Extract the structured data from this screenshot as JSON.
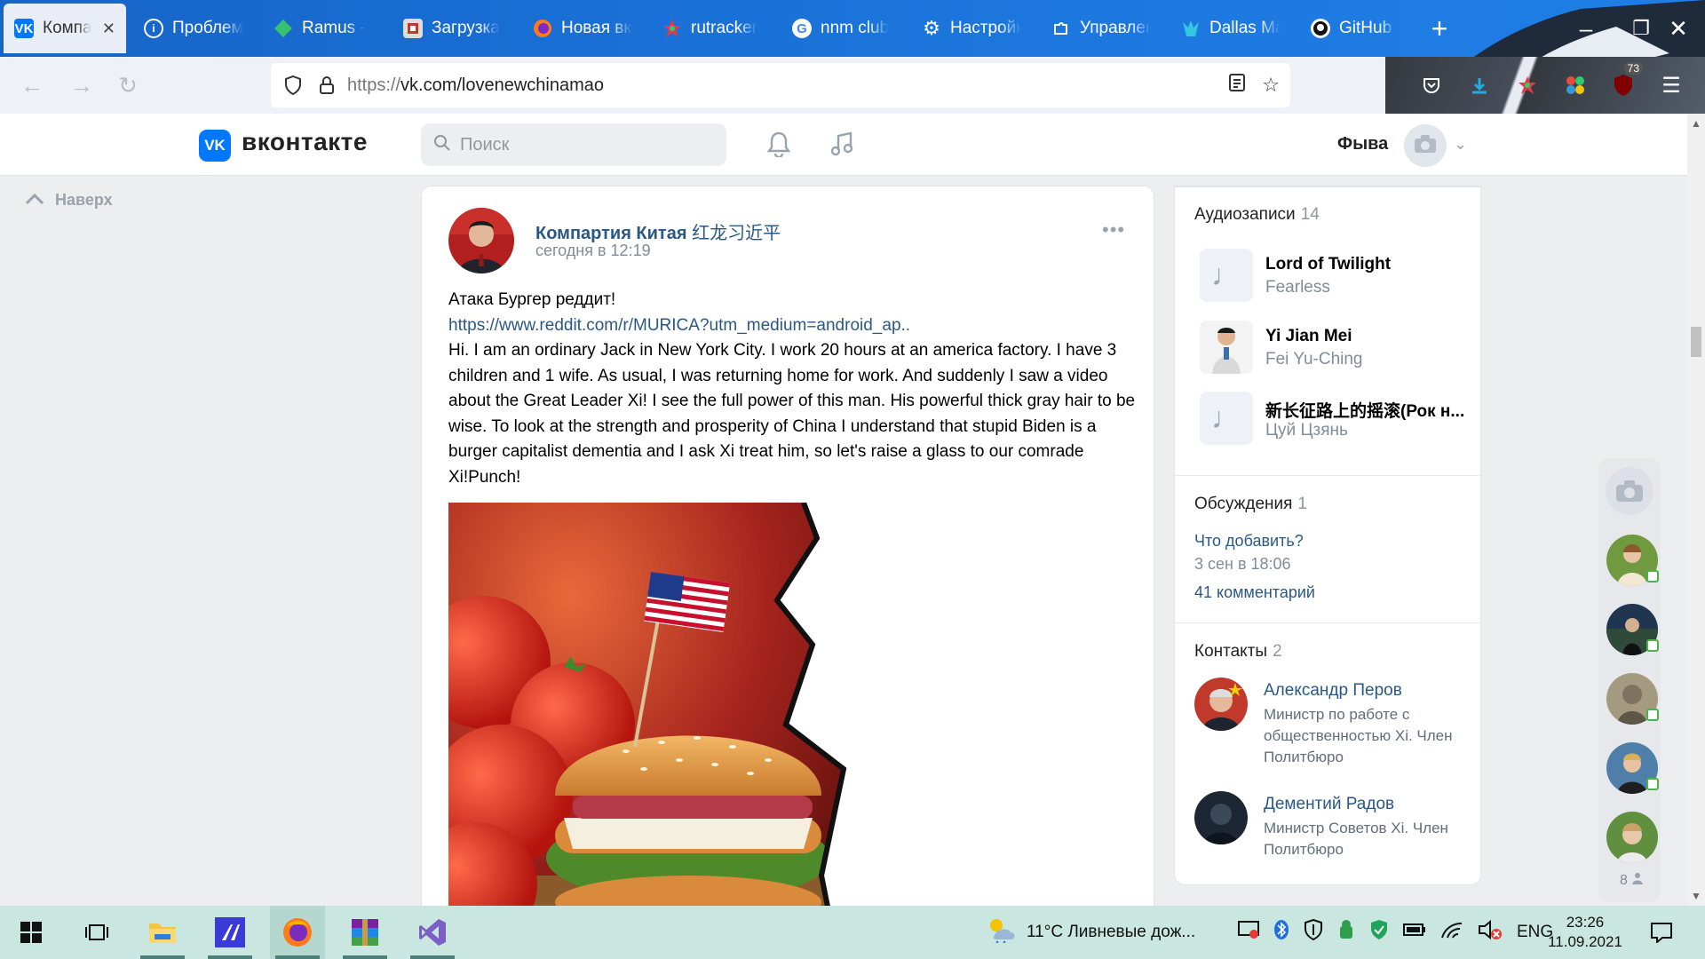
{
  "browser": {
    "tabs": [
      {
        "label": "Компартия Китая",
        "icon": "vk-icon",
        "active": true
      },
      {
        "label": "Проблема",
        "icon": "info-icon"
      },
      {
        "label": "Ramus -",
        "icon": "ramus-icon"
      },
      {
        "label": "Загрузка",
        "icon": "download-page-icon"
      },
      {
        "label": "Новая вкладка",
        "icon": "firefox-icon"
      },
      {
        "label": "rutracker",
        "icon": "rutracker-icon"
      },
      {
        "label": "nnm club",
        "icon": "google-icon"
      },
      {
        "label": "Настройки",
        "icon": "gear-icon"
      },
      {
        "label": "Управление",
        "icon": "puzzle-icon"
      },
      {
        "label": "Dallas Ma",
        "icon": "dallas-icon"
      },
      {
        "label": "GitHub -",
        "icon": "github-icon"
      }
    ],
    "new_tab": "+",
    "url": {
      "prefix": "https://",
      "domain": "vk.com",
      "path": "/lovenewchinamao"
    },
    "extension_badge": "73"
  },
  "vk": {
    "logo_text": "вконтакте",
    "search_placeholder": "Поиск",
    "user_name": "Фыва",
    "to_top": "Наверх"
  },
  "post": {
    "author": "Компартия Китая",
    "author_suffix": "红龙习近平",
    "time": "сегодня в 12:19",
    "title_line": "Атака Бургер реддит!",
    "link": "https://www.reddit.com/r/MURICA?utm_medium=android_ap..",
    "body": "Hi. I am an ordinary Jack in New York City. I work 20 hours at an america factory. I have 3 children and 1 wife. As usual, I was returning home for work. And suddenly I saw a video about the Great Leader Xi! I see the full power of this man. His powerful thick gray hair to be wise. To look at the strength and prosperity of China I understand that stupid Biden is a burger capitalist dementia and I ask Xi treat him, so let's raise a glass to our comrade Xi!Punch!"
  },
  "sidebar": {
    "audio": {
      "title": "Аудиозаписи",
      "count": "14",
      "tracks": [
        {
          "title": "Lord of Twilight",
          "artist": "Fearless"
        },
        {
          "title": "Yi Jian Mei",
          "artist": "Fei Yu-Ching"
        },
        {
          "title": "新长征路上的摇滚(Рок н...",
          "artist": "Цуй Цзянь"
        }
      ]
    },
    "discussions": {
      "title": "Обсуждения",
      "count": "1",
      "topic": "Что добавить?",
      "date": "3 сен в 18:06",
      "comments": "41 комментарий"
    },
    "contacts": {
      "title": "Контакты",
      "count": "2",
      "items": [
        {
          "name": "Александр Перов",
          "role": "Министр по работе с общественностью Xi. Член Политбюро"
        },
        {
          "name": "Дементий Радов",
          "role": "Министр Советов Xi. Член Политбюро"
        }
      ]
    }
  },
  "friends_strip": {
    "online_count": "8"
  },
  "taskbar": {
    "weather": "11°C  Ливневые дож...",
    "language": "ENG",
    "time": "23:26",
    "date": "11.09.2021"
  }
}
